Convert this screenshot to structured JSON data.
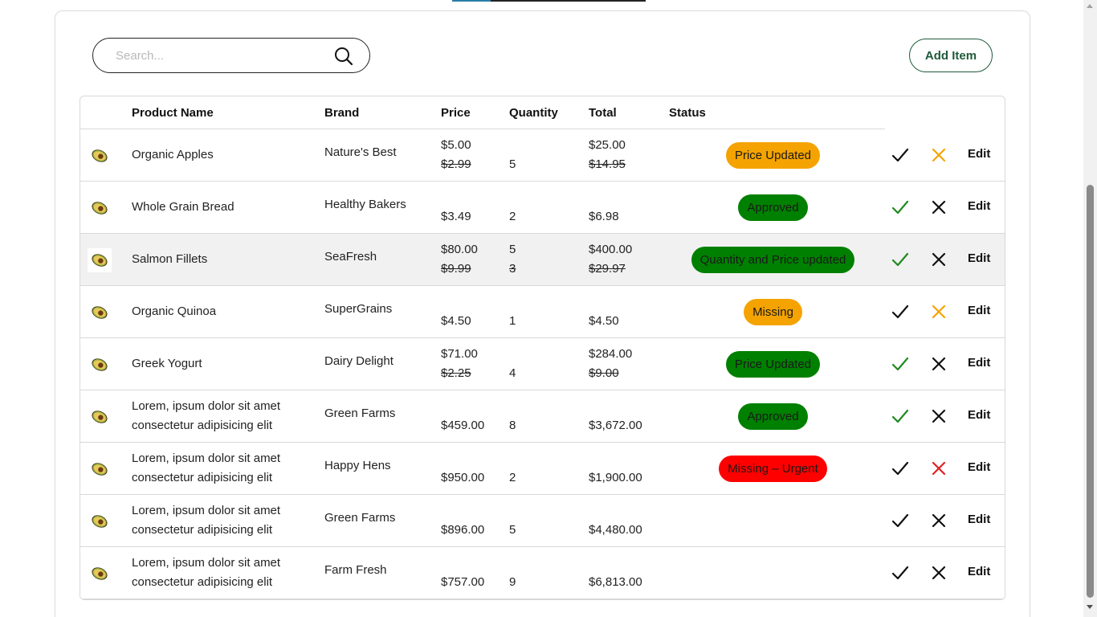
{
  "search": {
    "placeholder": "Search..."
  },
  "toolbar": {
    "add_item_label": "Add Item"
  },
  "table": {
    "headers": [
      "Product Name",
      "Brand",
      "Price",
      "Quantity",
      "Total",
      "Status"
    ],
    "edit_label": "Edit",
    "rows": [
      {
        "name": "Organic Apples",
        "brand": "Nature's Best",
        "price": "$5.00",
        "price_old": "$2.99",
        "qty": "5",
        "qty_old": "",
        "total": "$25.00",
        "total_old": "$14.95",
        "status": "Price Updated",
        "status_color": "#f5a300",
        "accept_color": "#111111",
        "reject_color": "#f5a300"
      },
      {
        "name": "Whole Grain Bread",
        "brand": "Healthy Bakers",
        "price": "$3.49",
        "price_old": "",
        "qty": "2",
        "qty_old": "",
        "total": "$6.98",
        "total_old": "",
        "status": "Approved",
        "status_color": "#008000",
        "accept_color": "#1e8a1e",
        "reject_color": "#111111"
      },
      {
        "name": "Salmon Fillets",
        "brand": "SeaFresh",
        "price": "$80.00",
        "price_old": "$9.99",
        "qty": "5",
        "qty_old": "3",
        "total": "$400.00",
        "total_old": "$29.97",
        "status": "Quantity and Price updated",
        "status_color": "#008000",
        "accept_color": "#1e8a1e",
        "reject_color": "#111111"
      },
      {
        "name": "Organic Quinoa",
        "brand": "SuperGrains",
        "price": "$4.50",
        "price_old": "",
        "qty": "1",
        "qty_old": "",
        "total": "$4.50",
        "total_old": "",
        "status": "Missing",
        "status_color": "#f5a300",
        "accept_color": "#111111",
        "reject_color": "#f5a300"
      },
      {
        "name": "Greek Yogurt",
        "brand": "Dairy Delight",
        "price": "$71.00",
        "price_old": "$2.25",
        "qty": "4",
        "qty_old": "",
        "total": "$284.00",
        "total_old": "$9.00",
        "status": "Price Updated",
        "status_color": "#008000",
        "accept_color": "#1e8a1e",
        "reject_color": "#111111"
      },
      {
        "name": "Lorem, ipsum dolor sit amet consectetur adipisicing elit",
        "brand": "Green Farms",
        "price": "$459.00",
        "price_old": "",
        "qty": "8",
        "qty_old": "",
        "total": "$3,672.00",
        "total_old": "",
        "status": "Approved",
        "status_color": "#008000",
        "accept_color": "#1e8a1e",
        "reject_color": "#111111"
      },
      {
        "name": "Lorem, ipsum dolor sit amet consectetur adipisicing elit",
        "brand": "Happy Hens",
        "price": "$950.00",
        "price_old": "",
        "qty": "2",
        "qty_old": "",
        "total": "$1,900.00",
        "total_old": "",
        "status": "Missing – Urgent",
        "status_color": "#ff0000",
        "accept_color": "#111111",
        "reject_color": "#e02020"
      },
      {
        "name": "Lorem, ipsum dolor sit amet consectetur adipisicing elit",
        "brand": "Green Farms",
        "price": "$896.00",
        "price_old": "",
        "qty": "5",
        "qty_old": "",
        "total": "$4,480.00",
        "total_old": "",
        "status": "",
        "status_color": "",
        "accept_color": "#111111",
        "reject_color": "#111111"
      },
      {
        "name": "Lorem, ipsum dolor sit amet consectetur adipisicing elit",
        "brand": "Farm Fresh",
        "price": "$757.00",
        "price_old": "",
        "qty": "9",
        "qty_old": "",
        "total": "$6,813.00",
        "total_old": "",
        "status": "",
        "status_color": "",
        "accept_color": "#111111",
        "reject_color": "#111111"
      }
    ]
  },
  "icons": {
    "search": "search-icon",
    "product": "avocado-icon",
    "accept": "checkmark-icon",
    "reject": "close-icon"
  }
}
